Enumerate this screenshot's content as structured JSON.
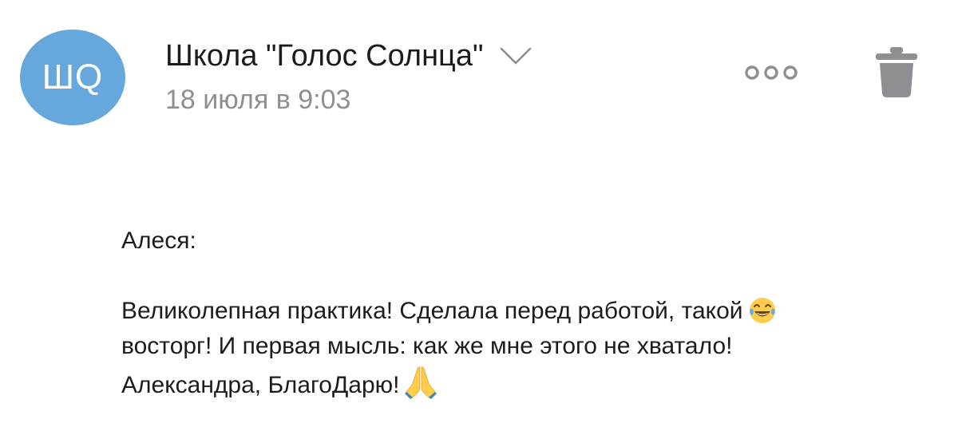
{
  "header": {
    "avatar_initials": "ШQ",
    "avatar_color": "#66a8dc",
    "sender_name": "Школа \"Голос Солнца\"",
    "date": "18 июля в 9:03",
    "icons": [
      "chevron-down-icon",
      "more-options-icon",
      "trash-icon"
    ]
  },
  "message": {
    "greeting": "Алеся:",
    "line1": "Великолепная практика! Сделала перед работой, такой",
    "line2": "восторг! И первая мысль: как же мне этого не хватало!",
    "line3": "Александра, БлагоДарю!",
    "emojis": [
      "laughing-tears-emoji",
      "praying-hands-emoji"
    ]
  }
}
